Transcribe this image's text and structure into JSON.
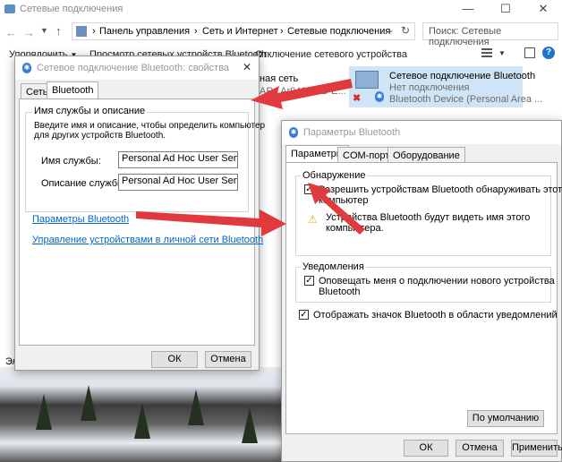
{
  "explorer": {
    "title": "Сетевые подключения",
    "breadcrumb": [
      "Панель управления",
      "Сеть и Интернет",
      "Сетевые подключения"
    ],
    "search_placeholder": "Поиск: Сетевые подключения",
    "toolbar": {
      "organize": "Упорядочить",
      "view_devices": "Просмотр сетевых устройств Bluetooth",
      "disable": "Отключение сетевого устройства"
    },
    "left_net_label": "ная сеть",
    "left_net_sub": "ARs Ar9485WB-E...",
    "bottom_left": "Эл",
    "bt_item": {
      "name": "Сетевое подключение Bluetooth",
      "status": "Нет подключения",
      "device": "Bluetooth Device (Personal Area ..."
    }
  },
  "props_dialog": {
    "title": "Сетевое подключение Bluetooth: свойства",
    "tabs": [
      "Сеть",
      "Bluetooth"
    ],
    "group_label": "Имя службы и описание",
    "group_desc": [
      "Введите имя и описание, чтобы определить компьютер",
      "для других устройств Bluetooth."
    ],
    "service_name_label": "Имя службы:",
    "service_name_value": "Personal Ad Hoc User Service",
    "service_desc_label": "Описание службы:",
    "service_desc_value": "Personal Ad Hoc User Service",
    "link_settings": "Параметры Bluetooth",
    "link_manage": "Управление устройствами в личной сети Bluetooth",
    "ok": "ОК",
    "cancel": "Отмена"
  },
  "bt_dialog": {
    "title": "Параметры Bluetooth",
    "tabs": [
      "Параметры",
      "COM-порты",
      "Оборудование"
    ],
    "discovery_label": "Обнаружение",
    "allow_discovery": [
      "Разрешить устройствам Bluetooth обнаруживать этот",
      "компьютер"
    ],
    "warning": [
      "Устройства Bluetooth будут видеть имя этого",
      "компьютера."
    ],
    "notifications_label": "Уведомления",
    "notify_new": [
      "Оповещать меня о подключении нового устройства",
      "Bluetooth"
    ],
    "show_icon": "Отображать значок Bluetooth в области уведомлений",
    "defaults": "По умолчанию",
    "ok": "ОК",
    "cancel": "Отмена",
    "apply": "Применить"
  },
  "colors": {
    "accent_arrow": "#e03a3e",
    "link": "#0066cc",
    "selection": "#cfe4f6"
  }
}
